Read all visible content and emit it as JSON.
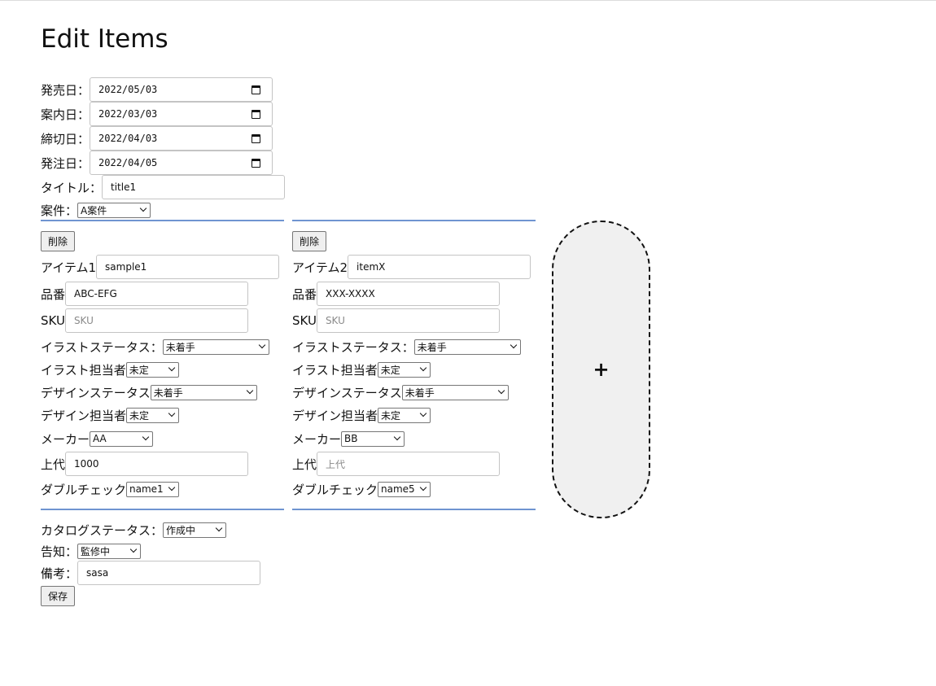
{
  "page": {
    "title": "Edit Items"
  },
  "header_fields": {
    "release_date": {
      "label": "発売日：",
      "value": "2022/05/03"
    },
    "notice_date": {
      "label": "案内日：",
      "value": "2022/03/03"
    },
    "deadline_date": {
      "label": "締切日：",
      "value": "2022/04/03"
    },
    "order_date": {
      "label": "発注日：",
      "value": "2022/04/05"
    },
    "title": {
      "label": "タイトル：",
      "value": "title1"
    },
    "project": {
      "label": "案件：",
      "selected": "A案件"
    }
  },
  "items": [
    {
      "delete_label": "削除",
      "item_label": "アイテム1",
      "item_value": "sample1",
      "part_label": "品番",
      "part_value": "ABC-EFG",
      "sku_label": "SKU",
      "sku_placeholder": "SKU",
      "illust_status_label": "イラストステータス：",
      "illust_status": "未着手",
      "illust_owner_label": "イラスト担当者",
      "illust_owner": "未定",
      "design_status_label": "デザインステータス",
      "design_status": "未着手",
      "design_owner_label": "デザイン担当者",
      "design_owner": "未定",
      "maker_label": "メーカー",
      "maker": "AA",
      "price_label": "上代",
      "price_value": "1000",
      "price_placeholder": "",
      "double_check_label": "ダブルチェック",
      "double_check": "name1"
    },
    {
      "delete_label": "削除",
      "item_label": "アイテム2",
      "item_value": "itemX",
      "part_label": "品番",
      "part_value": "XXX-XXXX",
      "sku_label": "SKU",
      "sku_placeholder": "SKU",
      "illust_status_label": "イラストステータス：",
      "illust_status": "未着手",
      "illust_owner_label": "イラスト担当者",
      "illust_owner": "未定",
      "design_status_label": "デザインステータス",
      "design_status": "未着手",
      "design_owner_label": "デザイン担当者",
      "design_owner": "未定",
      "maker_label": "メーカー",
      "maker": "BB",
      "price_label": "上代",
      "price_value": "",
      "price_placeholder": "上代",
      "double_check_label": "ダブルチェック",
      "double_check": "name5"
    }
  ],
  "add_item": {
    "label": "+"
  },
  "footer_fields": {
    "catalog_status": {
      "label": "カタログステータス：",
      "selected": "作成中"
    },
    "announcement": {
      "label": "告知：",
      "selected": "監修中"
    },
    "remarks": {
      "label": "備考：",
      "value": "sasa"
    },
    "save_label": "保存"
  },
  "colors": {
    "divider": "#6f94d1",
    "add_button_bg": "#f0f0f0"
  }
}
